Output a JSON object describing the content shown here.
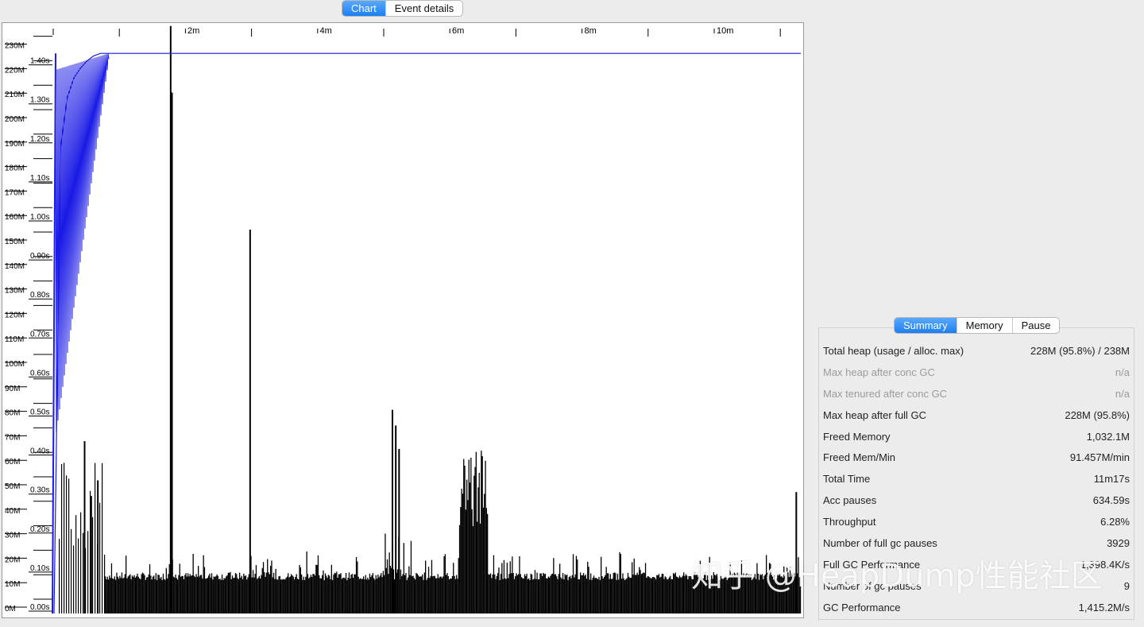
{
  "top_tabs": [
    {
      "label": "Chart",
      "active": true
    },
    {
      "label": "Event details",
      "active": false
    }
  ],
  "chart_data": {
    "type": "line",
    "x_axis": {
      "ticks": [
        "2m",
        "4m",
        "6m",
        "8m",
        "10m"
      ]
    },
    "y_heap_axis": {
      "ticks": [
        "0M",
        "10M",
        "20M",
        "30M",
        "40M",
        "50M",
        "60M",
        "70M",
        "80M",
        "90M",
        "100M",
        "110M",
        "120M",
        "130M",
        "140M",
        "150M",
        "160M",
        "170M",
        "180M",
        "190M",
        "200M",
        "210M",
        "220M",
        "230M"
      ]
    },
    "y_pause_axis": {
      "ticks": [
        "0.00s",
        "0.10s",
        "0.20s",
        "0.30s",
        "0.40s",
        "0.50s",
        "0.60s",
        "0.70s",
        "0.80s",
        "0.90s",
        "1.00s",
        "1.10s",
        "1.20s",
        "1.30s",
        "1.40s"
      ]
    },
    "series": [
      {
        "name": "",
        "color": "#1a1ae6",
        "note_values": "heap usage rising to ~228M within first minute then flat at ~228M until 11m17s"
      },
      {
        "name": "",
        "color": "#000000",
        "note_values": "GC pause bars"
      }
    ],
    "heap_line": {
      "x_min": [
        0.0,
        0.1,
        0.2,
        0.3,
        0.4,
        0.5,
        0.6,
        0.7,
        0.8,
        11.28
      ],
      "heap_M": [
        0,
        190,
        210,
        218,
        222,
        225,
        227,
        228,
        228,
        228
      ]
    },
    "pause_spikes": {
      "x_min": [
        0.45,
        0.55,
        0.65,
        1.75,
        1.77,
        2.95,
        5.1,
        5.15,
        5.2,
        11.2
      ],
      "pause_s": [
        0.44,
        0.3,
        0.34,
        1.5,
        1.33,
        0.98,
        0.52,
        0.48,
        0.42,
        0.31
      ]
    }
  },
  "summary_tabs": [
    {
      "label": "Summary",
      "active": true
    },
    {
      "label": "Memory",
      "active": false
    },
    {
      "label": "Pause",
      "active": false
    }
  ],
  "summary_rows": [
    {
      "label": "Total heap (usage / alloc. max)",
      "value": "228M (95.8%) / 238M",
      "dim": false
    },
    {
      "label": "Max heap after conc GC",
      "value": "n/a",
      "dim": true
    },
    {
      "label": "Max tenured after conc GC",
      "value": "n/a",
      "dim": true
    },
    {
      "label": "Max heap after full GC",
      "value": "228M (95.8%)",
      "dim": false
    },
    {
      "label": "Freed Memory",
      "value": "1,032.1M",
      "dim": false
    },
    {
      "label": "Freed Mem/Min",
      "value": "91.457M/min",
      "dim": false
    },
    {
      "label": "Total Time",
      "value": "11m17s",
      "dim": false
    },
    {
      "label": "Acc pauses",
      "value": "634.59s",
      "dim": false
    },
    {
      "label": "Throughput",
      "value": "6.28%",
      "dim": false
    },
    {
      "label": "Number of full gc pauses",
      "value": "3929",
      "dim": false
    },
    {
      "label": "Full GC Performance",
      "value": "1,398.4K/s",
      "dim": false
    },
    {
      "label": "Number of gc pauses",
      "value": "9",
      "dim": false
    },
    {
      "label": "GC Performance",
      "value": "1,415.2M/s",
      "dim": false
    }
  ],
  "watermark": "知乎 @HeapDump性能社区"
}
